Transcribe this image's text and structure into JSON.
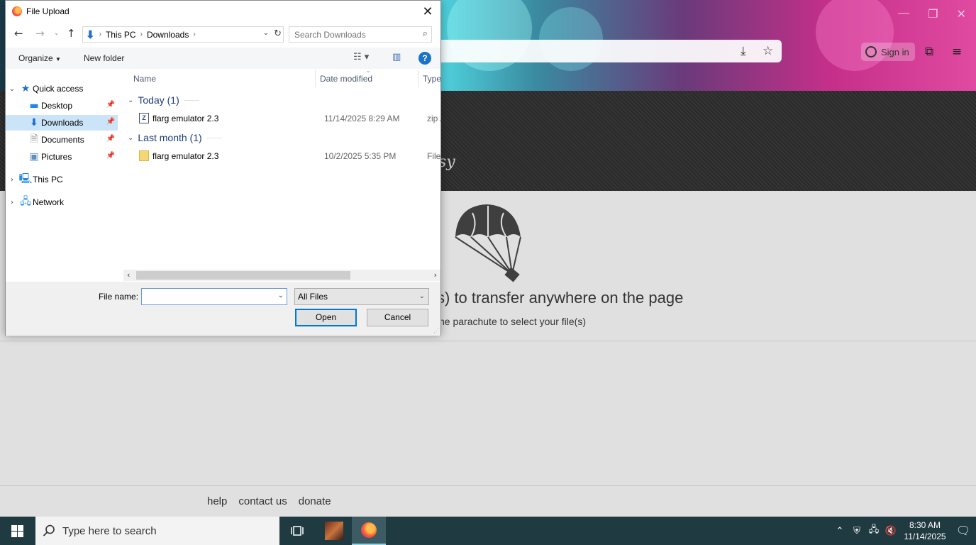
{
  "browser": {
    "signin_label": "Sign in",
    "band_text": "sy",
    "drop_title": "s) to transfer anywhere on the page",
    "drop_subtitle": "he parachute to select your file(s)",
    "footer_links": [
      "help",
      "contact us",
      "donate"
    ]
  },
  "taskbar": {
    "search_placeholder": "Type here to search",
    "time": "8:30 AM",
    "date": "11/14/2025"
  },
  "dialog": {
    "title": "File Upload",
    "breadcrumb": [
      "This PC",
      "Downloads"
    ],
    "search_placeholder": "Search Downloads",
    "organize_label": "Organize",
    "new_folder_label": "New folder",
    "help_glyph": "?",
    "nav_items": [
      {
        "label": "Quick access"
      },
      {
        "label": "Desktop"
      },
      {
        "label": "Downloads"
      },
      {
        "label": "Documents"
      },
      {
        "label": "Pictures"
      },
      {
        "label": "This PC"
      },
      {
        "label": "Network"
      }
    ],
    "columns": [
      "Name",
      "Date modified",
      "Type"
    ],
    "groups": [
      {
        "label": "Today (1)",
        "files": [
          {
            "name": "flarg emulator 2.3",
            "date": "11/14/2025 8:29 AM",
            "type": "zip Archive"
          }
        ]
      },
      {
        "label": "Last month (1)",
        "files": [
          {
            "name": "flarg emulator 2.3",
            "date": "10/2/2025 5:35 PM",
            "type": "File folder"
          }
        ]
      }
    ],
    "file_name_label": "File name:",
    "file_name_value": "",
    "file_type_value": "All Files",
    "open_label": "Open",
    "cancel_label": "Cancel"
  },
  "colors": {
    "accent": "#0078d7",
    "selected_bg": "#cce4f7",
    "taskbar_bg": "#1f3a40",
    "group_header": "#1e3c78"
  }
}
